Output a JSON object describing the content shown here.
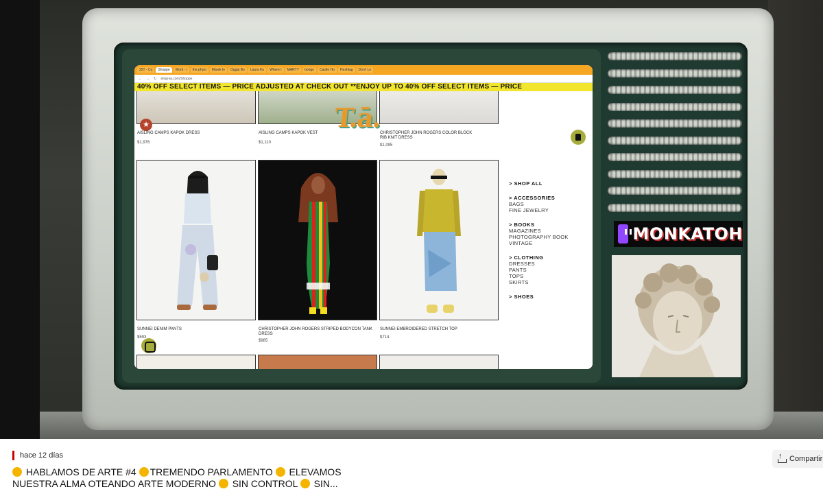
{
  "browser": {
    "tabs": [
      "25T - Co",
      "Shoppe",
      "Work - l",
      "the physi",
      "Marek lo",
      "Oggaj Bo",
      "Laura Ko",
      "Where t",
      "MARTY",
      "bongo",
      "Castle Ho",
      "Heshtag",
      "Don't Lo"
    ],
    "url": "shop-ta.com/Shoppe"
  },
  "site": {
    "ticker": "40% OFF SELECT ITEMS  — PRICE ADJUSTED AT CHECK OUT **ENJOY UP TO 40% OFF SELECT ITEMS  — PRICE",
    "logo": "T.ā.",
    "top_products": [
      {
        "name": "AISLING CAMPS KAPOK DRESS",
        "price": "$1,976"
      },
      {
        "name": "AISLING CAMPS KAPOK VEST",
        "price": "$1,110"
      },
      {
        "name": "CHRISTOPHER JOHN ROGERS COLOR BLOCK RIB KNIT DRESS",
        "price": "$1,095"
      }
    ],
    "products": [
      {
        "name": "SUNNEI DENIM PANTS",
        "price": "$593"
      },
      {
        "name": "CHRISTOPHER JOHN ROGERS STRIPED BODYCON TANK DRESS",
        "price": "$985"
      },
      {
        "name": "SUNNEI EMBROIDERED STRETCH TOP",
        "price": "$714"
      }
    ],
    "sidebar": {
      "shop_all": "> SHOP ALL",
      "accessories": "> ACCESSORIES",
      "accessories_items": [
        "BAGS",
        "FINE JEWELRY"
      ],
      "books": "> BOOKS",
      "books_items": [
        "MAGAZINES",
        "PHOTOGRAPHY BOOK",
        "VINTAGE"
      ],
      "clothing": "> CLOTHING",
      "clothing_items": [
        "DRESSES",
        "PANTS",
        "TOPS",
        "SKIRTS"
      ],
      "shoes": "> SHOES"
    }
  },
  "stream": {
    "channel": "MONKATOH"
  },
  "video": {
    "time_ago": "hace 12 días",
    "share": "Compartir",
    "title_line1": "HABLAMOS DE ARTE #4",
    "title_line1b": "TREMENDO PARLAMENTO",
    "title_line1c": "ELEVAMOS",
    "title_line2": "NUESTRA ALMA OTEANDO ARTE MODERNO",
    "title_line2b": "SIN CONTROL",
    "title_line2c": "SIN..."
  },
  "colors": {
    "chrome_orange": "#f5a623",
    "ticker_yellow": "#f2e52e",
    "accent_olive": "#a6ad3a",
    "twitch_purple": "#9146ff"
  }
}
